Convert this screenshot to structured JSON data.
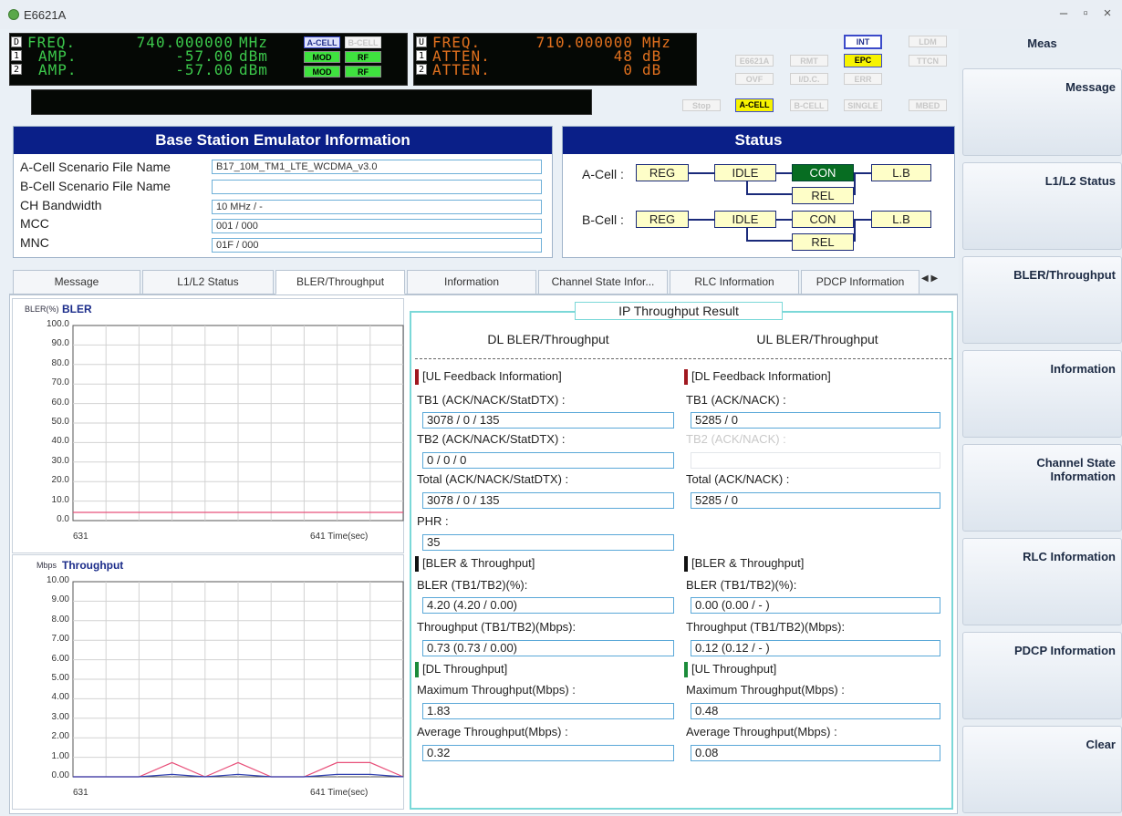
{
  "window": {
    "title": "E6621A"
  },
  "led_left": {
    "freq_label": "FREQ.",
    "freq_value": "740.000000",
    "freq_unit": "MHz",
    "amp1_label": "AMP.",
    "amp1_value": "-57.00",
    "amp1_unit": "dBm",
    "amp2_label": "AMP.",
    "amp2_value": "-57.00",
    "amp2_unit": "dBm",
    "idx": [
      "D",
      "1",
      "2"
    ]
  },
  "led_right": {
    "freq_label": "FREQ.",
    "freq_value": "710.000000",
    "freq_unit": "MHz",
    "atten1_label": "ATTEN.",
    "atten1_value": "48",
    "atten1_unit": "dB",
    "atten2_label": "ATTEN.",
    "atten2_value": "0",
    "atten2_unit": "dB",
    "idx": [
      "U",
      "1",
      "2"
    ]
  },
  "chips": {
    "a_cell": "A-CELL",
    "b_cell": "B-CELL",
    "mod1": "MOD",
    "rf1": "RF",
    "mod2": "MOD",
    "rf2": "RF",
    "int": "INT",
    "ldm": "LDM",
    "epc": "EPC",
    "ttcn": "TTCN",
    "e6621a": "E6621A",
    "rmt": "RMT",
    "ovf": "OVF",
    "idc": "I/D.C.",
    "err": "ERR",
    "stop": "Stop",
    "acell2": "A-CELL",
    "bcell2": "B-CELL",
    "single": "SINGLE",
    "mbed": "MBED"
  },
  "bs_info": {
    "title": "Base Station Emulator Information",
    "rows": [
      {
        "label": "A-Cell Scenario File Name",
        "value": "B17_10M_TM1_LTE_WCDMA_v3.0"
      },
      {
        "label": "B-Cell Scenario File Name",
        "value": ""
      },
      {
        "label": "CH Bandwidth",
        "value": "10 MHz / -"
      },
      {
        "label": "MCC",
        "value": "001 / 000"
      },
      {
        "label": "MNC",
        "value": "01F / 000"
      }
    ]
  },
  "status": {
    "title": "Status",
    "a_cell": {
      "label": "A-Cell :",
      "reg": "REG",
      "idle": "IDLE",
      "con": "CON",
      "lb": "L.B",
      "rel": "REL"
    },
    "b_cell": {
      "label": "B-Cell :",
      "reg": "REG",
      "idle": "IDLE",
      "con": "CON",
      "lb": "L.B",
      "rel": "REL"
    }
  },
  "tabs": [
    "Message",
    "L1/L2 Status",
    "BLER/Throughput",
    "Information",
    "Channel State Infor...",
    "RLC Information",
    "PDCP Information"
  ],
  "tab_scroll": "◀ ▶",
  "bler_chart": {
    "unit": "BLER(%)",
    "title": "BLER",
    "yticks": [
      "100.0",
      "90.0",
      "80.0",
      "70.0",
      "60.0",
      "50.0",
      "40.0",
      "30.0",
      "20.0",
      "10.0",
      "0.0"
    ],
    "x_start": "631",
    "x_end": "641 Time(sec)"
  },
  "thr_chart": {
    "unit": "Mbps",
    "title": "Throughput",
    "yticks": [
      "10.00",
      "9.00",
      "8.00",
      "7.00",
      "6.00",
      "5.00",
      "4.00",
      "3.00",
      "2.00",
      "1.00",
      "0.00"
    ],
    "x_start": "631",
    "x_end": "641 Time(sec)"
  },
  "chart_data": [
    {
      "type": "line",
      "title": "BLER",
      "ylabel": "BLER(%)",
      "xlabel": "Time(sec)",
      "ylim": [
        0,
        100
      ],
      "xlim": [
        631,
        641
      ],
      "series": [
        {
          "color": "#e8507a",
          "x": [
            631,
            632,
            633,
            634,
            635,
            636,
            637,
            638,
            639,
            640,
            641
          ],
          "values": [
            4.2,
            4.2,
            4.2,
            4.2,
            4.2,
            4.2,
            4.2,
            4.2,
            4.2,
            4.2,
            4.2
          ]
        }
      ]
    },
    {
      "type": "line",
      "title": "Throughput",
      "ylabel": "Mbps",
      "xlabel": "Time(sec)",
      "ylim": [
        0,
        10
      ],
      "xlim": [
        631,
        641
      ],
      "series": [
        {
          "color": "#e8507a",
          "x": [
            631,
            632,
            633,
            634,
            635,
            636,
            637,
            638,
            639,
            640,
            641
          ],
          "values": [
            0,
            0,
            0,
            0.73,
            0,
            0.73,
            0,
            0,
            0.73,
            0.73,
            0
          ]
        },
        {
          "color": "#3040b0",
          "x": [
            631,
            632,
            633,
            634,
            635,
            636,
            637,
            638,
            639,
            640,
            641
          ],
          "values": [
            0,
            0,
            0,
            0.12,
            0,
            0.12,
            0,
            0,
            0.12,
            0.12,
            0
          ]
        }
      ]
    }
  ],
  "ip_result": {
    "title": "IP Throughput Result",
    "dl_header": "DL BLER/Throughput",
    "ul_header": "UL BLER/Throughput",
    "left": {
      "ul_feedback": "[UL Feedback Information]",
      "tb1_label": "TB1 (ACK/NACK/StatDTX) :",
      "tb1_value": "3078 / 0 / 135",
      "tb2_label": "TB2 (ACK/NACK/StatDTX) :",
      "tb2_value": "0 / 0 / 0",
      "total_label": "Total (ACK/NACK/StatDTX) :",
      "total_value": "3078 / 0 / 135",
      "phr_label": "PHR :",
      "phr_value": "35",
      "bler_thr": "[BLER & Throughput]",
      "bler_label": "BLER (TB1/TB2)(%):",
      "bler_value": "4.20 (4.20 / 0.00)",
      "thr_label": "Throughput (TB1/TB2)(Mbps):",
      "thr_value": "0.73 (0.73 / 0.00)",
      "dl_thr": "[DL Throughput]",
      "max_label": "Maximum Throughput(Mbps) :",
      "max_value": "1.83",
      "avg_label": "Average Throughput(Mbps) :",
      "avg_value": "0.32"
    },
    "right": {
      "dl_feedback": "[DL Feedback Information]",
      "tb1_label": "TB1 (ACK/NACK) :",
      "tb1_value": "5285 / 0",
      "tb2_label": "TB2 (ACK/NACK) :",
      "tb2_value": "",
      "total_label": "Total (ACK/NACK) :",
      "total_value": "5285 / 0",
      "bler_thr": "[BLER & Throughput]",
      "bler_label": "BLER (TB1/TB2)(%):",
      "bler_value": "0.00 (0.00 / - )",
      "thr_label": "Throughput (TB1/TB2)(Mbps):",
      "thr_value": "0.12 (0.12 / - )",
      "ul_thr": "[UL Throughput]",
      "max_label": "Maximum Throughput(Mbps) :",
      "max_value": "0.48",
      "avg_label": "Average Throughput(Mbps) :",
      "avg_value": "0.08"
    }
  },
  "right_panel": {
    "header": "Meas",
    "buttons": [
      "Message",
      "L1/L2 Status",
      "BLER/Throughput",
      "Information",
      "Channel State Information",
      "RLC Information",
      "PDCP Information",
      "Clear"
    ]
  }
}
